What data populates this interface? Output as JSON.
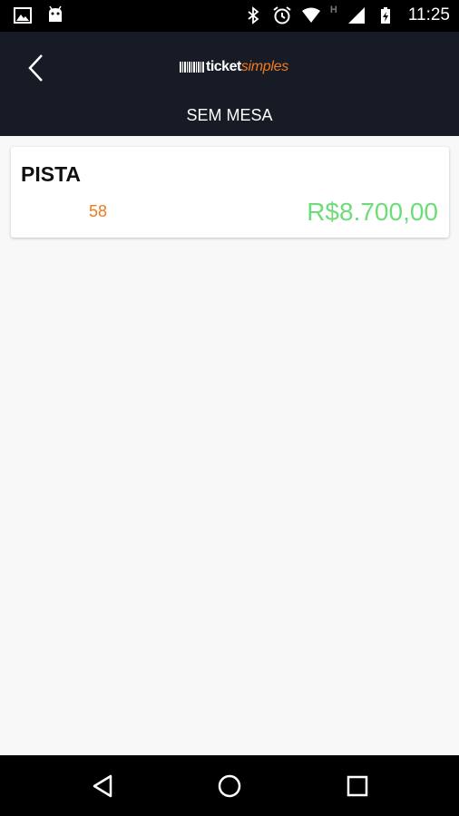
{
  "status_bar": {
    "time": "11:25",
    "network_mark": "H",
    "icons": [
      "image-icon",
      "android-icon",
      "bluetooth-icon",
      "alarm-icon",
      "wifi-icon",
      "signal-icon",
      "battery-charging-icon"
    ]
  },
  "header": {
    "logo_ticket": "ticket",
    "logo_simples": "simples",
    "section_title": "SEM MESA"
  },
  "ticket": {
    "name": "PISTA",
    "quantity": "58",
    "price": "R$8.700,00"
  },
  "colors": {
    "header_bg": "#171b26",
    "accent_orange": "#f07a1d",
    "price_green": "#6fdc7a",
    "page_bg": "#f8f8f8"
  },
  "nav_bar": {
    "icons": [
      "back-triangle-icon",
      "home-circle-icon",
      "recent-square-icon"
    ]
  }
}
